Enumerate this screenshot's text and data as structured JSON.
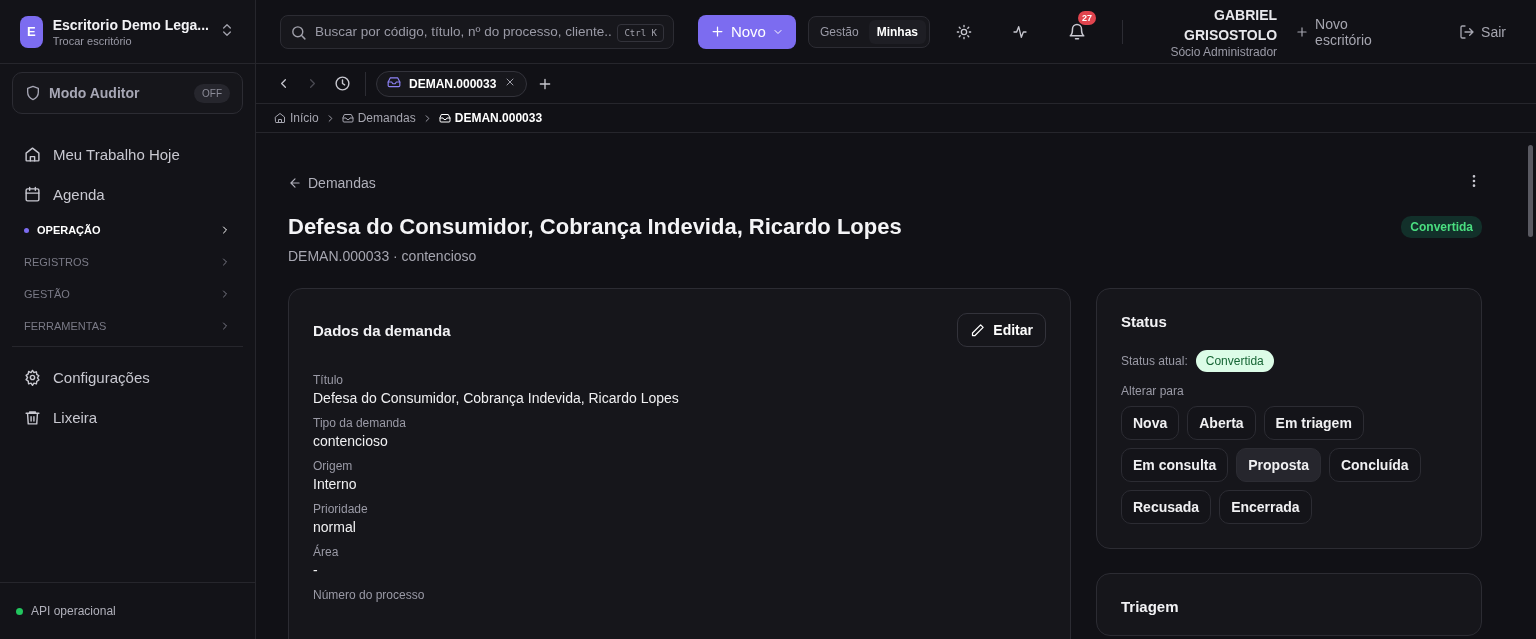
{
  "sidebar": {
    "org": {
      "initial": "E",
      "name": "Escritorio Demo Lega...",
      "subtitle": "Trocar escritório"
    },
    "auditor": {
      "label": "Modo Auditor",
      "toggle": "OFF",
      "on": false
    },
    "items": [
      {
        "kind": "link",
        "label": "Meu Trabalho Hoje"
      },
      {
        "kind": "link",
        "label": "Agenda"
      },
      {
        "kind": "section",
        "label": "OPERAÇÃO",
        "selected": true
      },
      {
        "kind": "section",
        "label": "REGISTROS",
        "selected": false
      },
      {
        "kind": "section",
        "label": "GESTÃO",
        "selected": false
      },
      {
        "kind": "section",
        "label": "FERRAMENTAS",
        "selected": false
      },
      {
        "kind": "divider"
      },
      {
        "kind": "link",
        "label": "Configurações"
      },
      {
        "kind": "link",
        "label": "Lixeira"
      }
    ],
    "status": {
      "label": "API operacional",
      "color": "#22c55e"
    }
  },
  "topbar": {
    "search": {
      "placeholder": "Buscar por código, título, nº do processo, cliente...",
      "shortcut": "Ctrl K"
    },
    "new_button": "Novo",
    "scope": [
      {
        "label": "Gestão",
        "selected": false
      },
      {
        "label": "Minhas",
        "selected": true
      }
    ],
    "notifications": "27",
    "user": {
      "name": "GABRIEL GRISOSTOLO",
      "role": "Sócio Administrador"
    },
    "new_office": "Novo escritório",
    "logout": "Sair"
  },
  "tabbar": {
    "forward_disabled": true,
    "tabs": [
      {
        "label": "DEMAN.000033",
        "selected": true
      }
    ]
  },
  "breadcrumb": [
    {
      "label": "Início"
    },
    {
      "label": "Demandas"
    },
    {
      "label": "DEMAN.000033"
    }
  ],
  "page": {
    "back": "Demandas",
    "title": "Defesa do Consumidor, Cobrança Indevida, Ricardo Lopes",
    "badge": "Convertida",
    "subtitle": "DEMAN.000033 · contencioso"
  },
  "details": {
    "title": "Dados da demanda",
    "edit": "Editar",
    "fields": [
      {
        "label": "Título",
        "value": "Defesa do Consumidor, Cobrança Indevida, Ricardo Lopes"
      },
      {
        "label": "Tipo da demanda",
        "value": "contencioso"
      },
      {
        "label": "Origem",
        "value": "Interno"
      },
      {
        "label": "Prioridade",
        "value": "normal"
      },
      {
        "label": "Área",
        "value": "-"
      },
      {
        "label": "Número do processo"
      }
    ]
  },
  "status_card": {
    "title": "Status",
    "current_label": "Status atual:",
    "current": "Convertida",
    "change_label": "Alterar para",
    "options": [
      {
        "label": "Nova",
        "hovered": false
      },
      {
        "label": "Aberta",
        "hovered": false
      },
      {
        "label": "Em triagem",
        "hovered": false
      },
      {
        "label": "Em consulta",
        "hovered": false
      },
      {
        "label": "Proposta",
        "hovered": true
      },
      {
        "label": "Concluída",
        "hovered": false
      },
      {
        "label": "Recusada",
        "hovered": false
      },
      {
        "label": "Encerrada",
        "hovered": false
      }
    ]
  },
  "triage_card": {
    "title": "Triagem"
  }
}
